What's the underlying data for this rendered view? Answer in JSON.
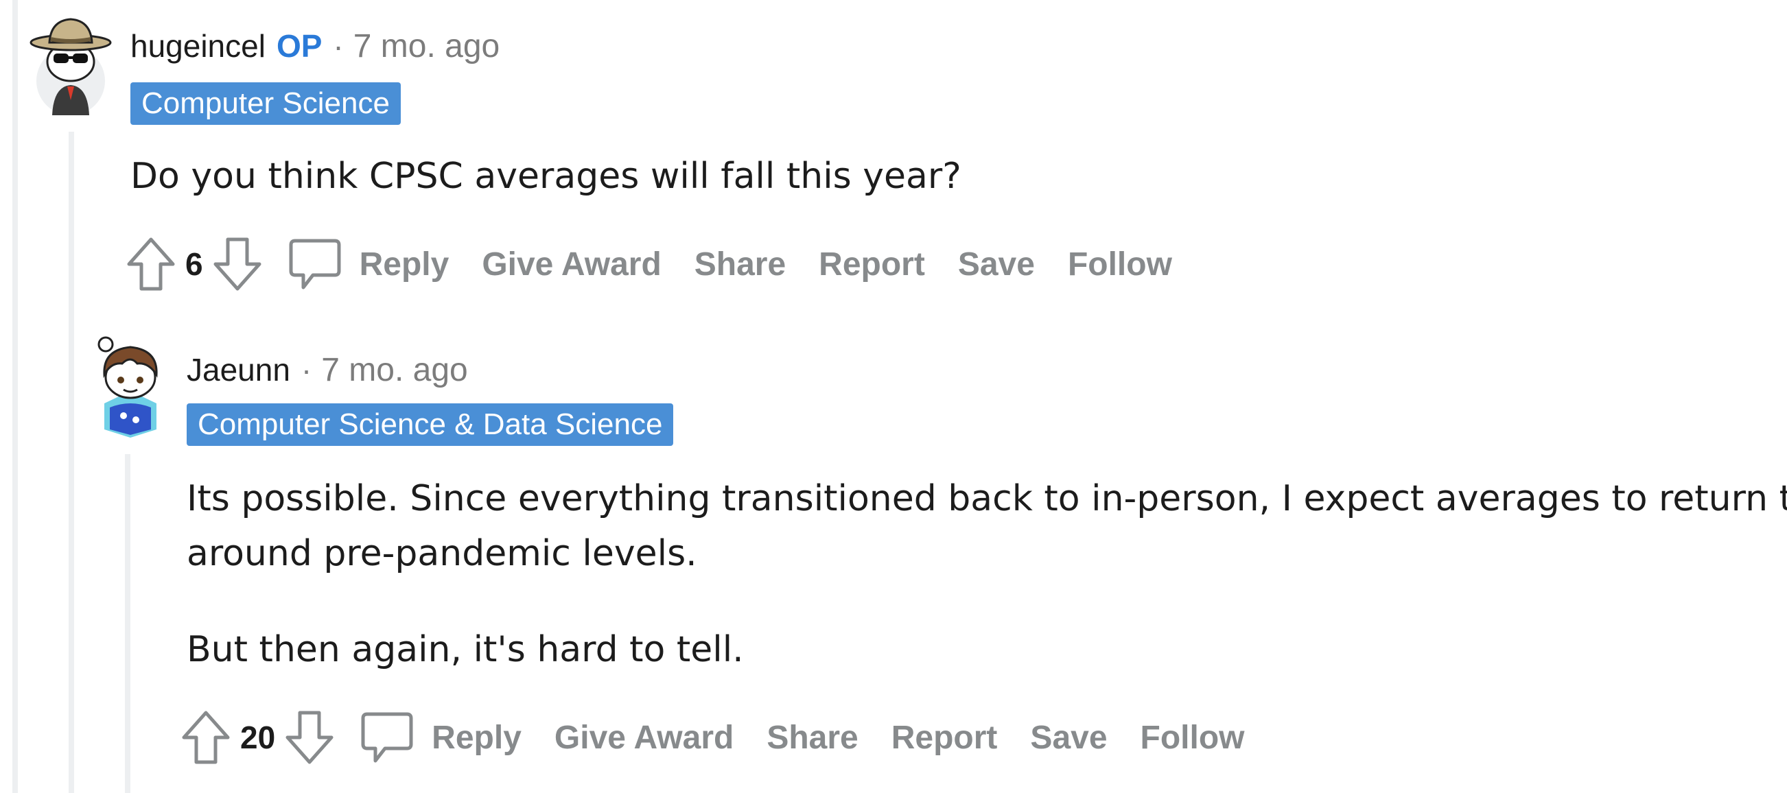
{
  "comments": [
    {
      "username": "hugeincel",
      "op_label": "OP",
      "separator": "·",
      "time": "7 mo. ago",
      "flair": "Computer Science",
      "body": [
        "Do you think CPSC averages will fall this year?"
      ],
      "votes": "6",
      "actions": {
        "reply": "Reply",
        "award": "Give Award",
        "share": "Share",
        "report": "Report",
        "save": "Save",
        "follow": "Follow"
      }
    },
    {
      "username": "Jaeunn",
      "separator": "·",
      "time": "7 mo. ago",
      "flair": "Computer Science & Data Science",
      "body": [
        "Its possible. Since everything transitioned back to in-person, I expect averages to return to",
        "around pre-pandemic levels.",
        "But then again, it's hard to tell."
      ],
      "votes": "20",
      "actions": {
        "reply": "Reply",
        "award": "Give Award",
        "share": "Share",
        "report": "Report",
        "save": "Save",
        "follow": "Follow"
      }
    }
  ],
  "icons": {
    "upvote": "upvote-arrow-icon",
    "downvote": "downvote-arrow-icon",
    "comment": "comment-bubble-icon"
  },
  "colors": {
    "flair_bg": "#4a8fd6",
    "op_label": "#2a7ad8",
    "action_text": "#878a8c",
    "thread_line": "#edeff1"
  }
}
